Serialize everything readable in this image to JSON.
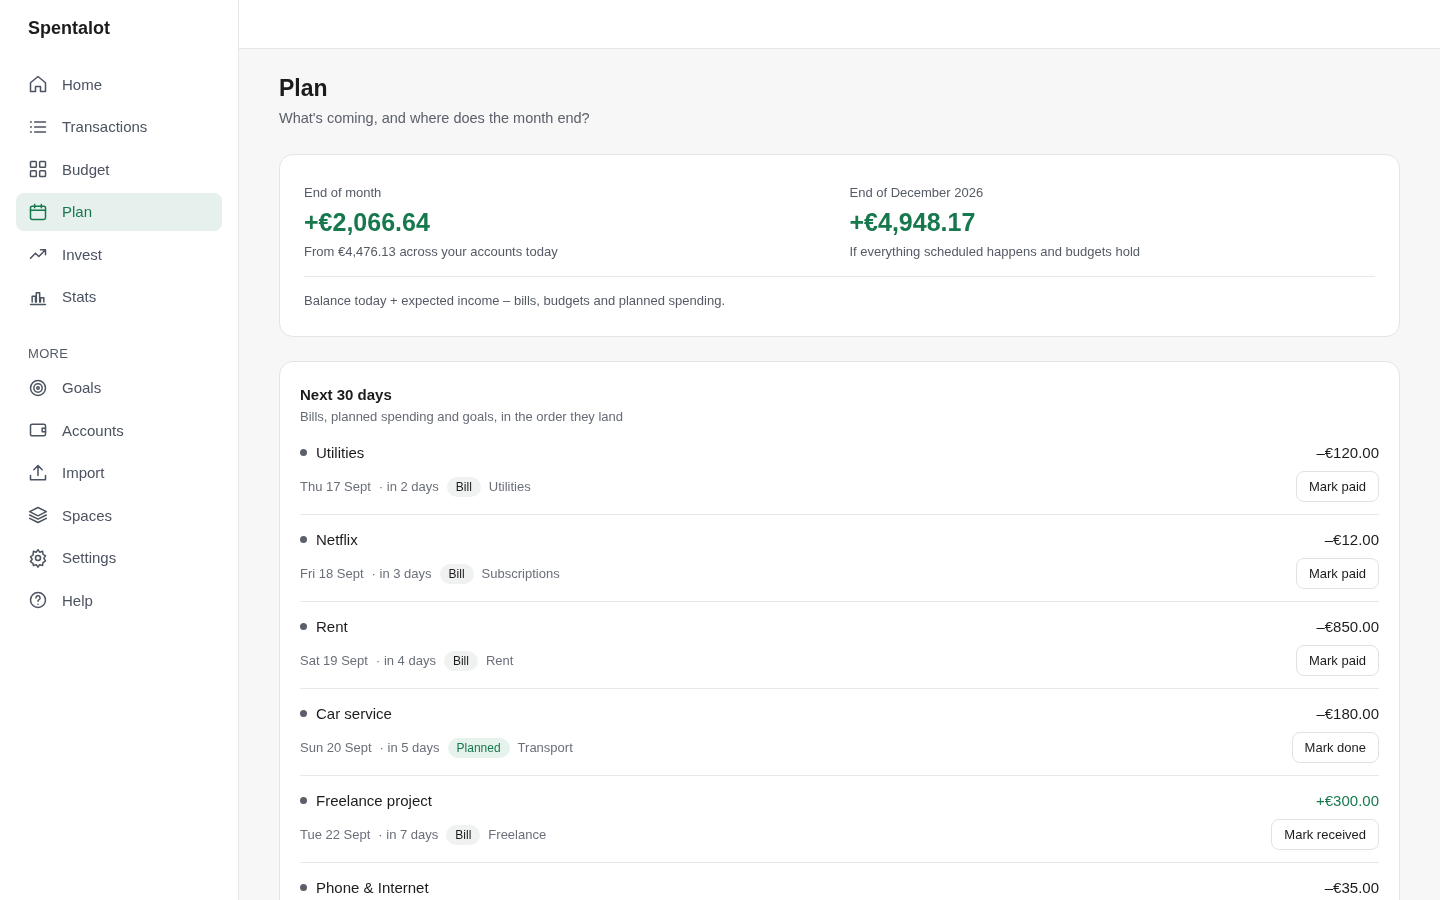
{
  "brand": "Spentalot",
  "nav": [
    {
      "label": "Home",
      "selected": false
    },
    {
      "label": "Transactions",
      "selected": false
    },
    {
      "label": "Budget",
      "selected": false
    },
    {
      "label": "Plan",
      "selected": true
    },
    {
      "label": "Invest",
      "selected": false
    },
    {
      "label": "Stats",
      "selected": false
    }
  ],
  "more_heading": "MORE",
  "more_nav": [
    {
      "label": "Goals",
      "selected": false
    },
    {
      "label": "Accounts",
      "selected": false
    },
    {
      "label": "Import",
      "selected": false
    },
    {
      "label": "Spaces",
      "selected": false
    },
    {
      "label": "Settings",
      "selected": false
    },
    {
      "label": "Help",
      "selected": false
    }
  ],
  "page": {
    "title": "Plan",
    "subtitle": "What's coming, and where does the month end?"
  },
  "forecast": {
    "stats": [
      {
        "label": "End of month",
        "value": "+€2,066.64",
        "note": "From €4,476.13 across your accounts today"
      },
      {
        "label": "End of December 2026",
        "value": "+€4,948.17",
        "note": "If everything scheduled happens and budgets hold"
      }
    ],
    "footnote": "Balance today + expected income – bills, budgets and planned spending."
  },
  "upcoming": {
    "title": "Next 30 days",
    "subtitle": "Bills, planned spending and goals, in the order they land",
    "items": [
      {
        "name": "Utilities",
        "amount": "–€120.00",
        "income": false,
        "date": "Thu 17 Sept",
        "relative": "· in 2 days",
        "tag": {
          "label": "Bill",
          "kind": "bill"
        },
        "category": "Utilities",
        "action": "Mark paid"
      },
      {
        "name": "Netflix",
        "amount": "–€12.00",
        "income": false,
        "date": "Fri 18 Sept",
        "relative": "· in 3 days",
        "tag": {
          "label": "Bill",
          "kind": "bill"
        },
        "category": "Subscriptions",
        "action": "Mark paid"
      },
      {
        "name": "Rent",
        "amount": "–€850.00",
        "income": false,
        "date": "Sat 19 Sept",
        "relative": "· in 4 days",
        "tag": {
          "label": "Bill",
          "kind": "bill"
        },
        "category": "Rent",
        "action": "Mark paid"
      },
      {
        "name": "Car service",
        "amount": "–€180.00",
        "income": false,
        "date": "Sun 20 Sept",
        "relative": "· in 5 days",
        "tag": {
          "label": "Planned",
          "kind": "planned"
        },
        "category": "Transport",
        "action": "Mark done"
      },
      {
        "name": "Freelance project",
        "amount": "+€300.00",
        "income": true,
        "date": "Tue 22 Sept",
        "relative": "· in 7 days",
        "tag": {
          "label": "Bill",
          "kind": "bill"
        },
        "category": "Freelance",
        "action": "Mark received"
      },
      {
        "name": "Phone & Internet",
        "amount": "–€35.00",
        "income": false
      }
    ]
  }
}
